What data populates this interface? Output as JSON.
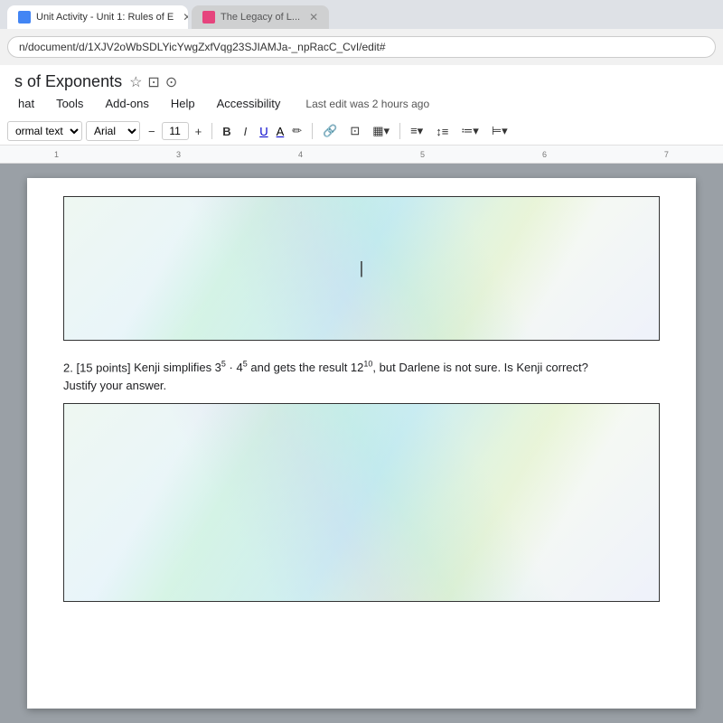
{
  "browser": {
    "tabs": [
      {
        "id": "tab1",
        "label": "Unit Activity - Unit 1: Rules of E",
        "active": true,
        "icon_color": "#4285f4"
      },
      {
        "id": "tab2",
        "label": "The Legacy of L...",
        "active": false,
        "icon_color": "#e91e63"
      }
    ],
    "address": "n/document/d/1XJV2oWbSDLYicYwgZxfVqg23SJIAMJa-_npRacC_CvI/edit#"
  },
  "docs": {
    "title": "s of Exponents",
    "title_icons": {
      "star": "☆",
      "folder": "⊡",
      "cloud": "⊙"
    },
    "menu": {
      "items": [
        "hat",
        "Tools",
        "Add-ons",
        "Help",
        "Accessibility"
      ]
    },
    "last_edit": "Last edit was 2 hours ago",
    "toolbar": {
      "paragraph_style": "ormal text",
      "font": "Arial",
      "font_size": "11",
      "bold": "B",
      "italic": "I",
      "underline": "U",
      "font_color_label": "A",
      "minus": "−",
      "plus": "+"
    },
    "ruler": {
      "marks": [
        "1",
        "3",
        "4",
        "5",
        "6",
        "7"
      ]
    },
    "questions": [
      {
        "number": "2.",
        "points": "[15 points]",
        "text": " Kenji simplifies 3",
        "base1": "5",
        "dot": " · 4",
        "base2": "5",
        "result_text": " and gets the result 12",
        "result_exp": "10",
        "end_text": ", but Darlene is not sure. Is Kenji correct?",
        "justify": "Justify your answer."
      }
    ]
  }
}
